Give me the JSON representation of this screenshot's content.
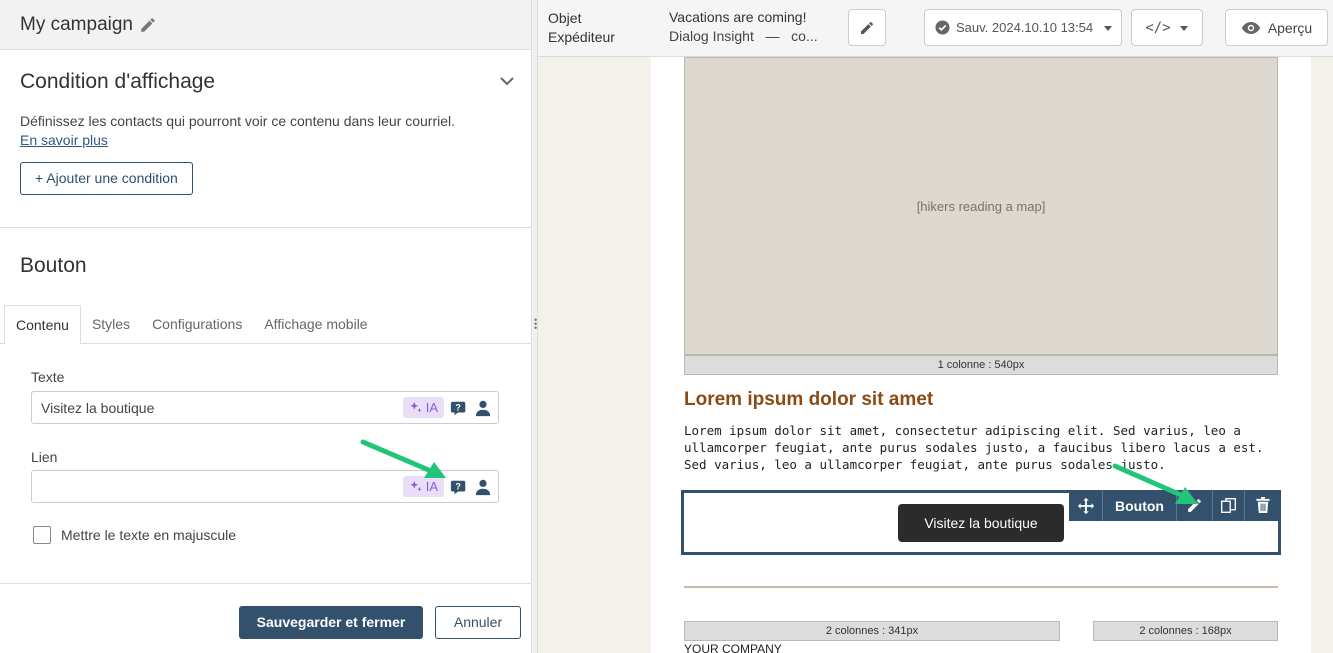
{
  "campaign": {
    "title": "My campaign"
  },
  "condition": {
    "heading": "Condition d'affichage",
    "description": "Définissez les contacts qui pourront voir ce contenu dans leur courriel.",
    "learn_more": "En savoir plus",
    "add_button": "+ Ajouter une condition"
  },
  "bouton_section": {
    "heading": "Bouton"
  },
  "tabs": [
    {
      "label": "Contenu",
      "active": true
    },
    {
      "label": "Styles"
    },
    {
      "label": "Configurations"
    },
    {
      "label": "Affichage mobile"
    }
  ],
  "fields": {
    "texte": {
      "label": "Texte",
      "value": "Visitez la boutique",
      "ia": "IA"
    },
    "lien": {
      "label": "Lien",
      "value": "",
      "ia": "IA"
    }
  },
  "uppercase_checkbox": {
    "label": "Mettre le texte en majuscule",
    "checked": false
  },
  "actions": {
    "save": "Sauvegarder et fermer",
    "cancel": "Annuler"
  },
  "topbar": {
    "labels": {
      "subject": "Objet",
      "sender": "Expéditeur"
    },
    "subject_value": "Vacations are coming!",
    "sender_value": "Dialog Insight   —   co...",
    "save_status": "Sauv. 2024.10.10 13:54",
    "code_label": "</>",
    "preview": "Aperçu"
  },
  "email": {
    "photo_alt": "[hikers reading a map]",
    "photo_label": "1 colonne : 540px",
    "heading": "Lorem ipsum dolor sit amet",
    "body": "Lorem ipsum dolor sit amet, consectetur adipiscing elit. Sed varius, leo a ullamcorper feugiat, ante purus sodales justo, a faucibus libero lacus a est. Sed varius, leo a ullamcorper feugiat, ante purus sodales justo.",
    "button_text": "Visitez la boutique",
    "toolbar_label": "Bouton",
    "col_left_label": "2 colonnes : 341px",
    "col_right_label": "2 colonnes : 168px",
    "company": "YOUR COMPANY"
  },
  "colors": {
    "accent": "#33516d",
    "heading_brown": "#8b4a14",
    "arrow_green": "#22c47a",
    "ia_purple": "#8a5bd6"
  }
}
